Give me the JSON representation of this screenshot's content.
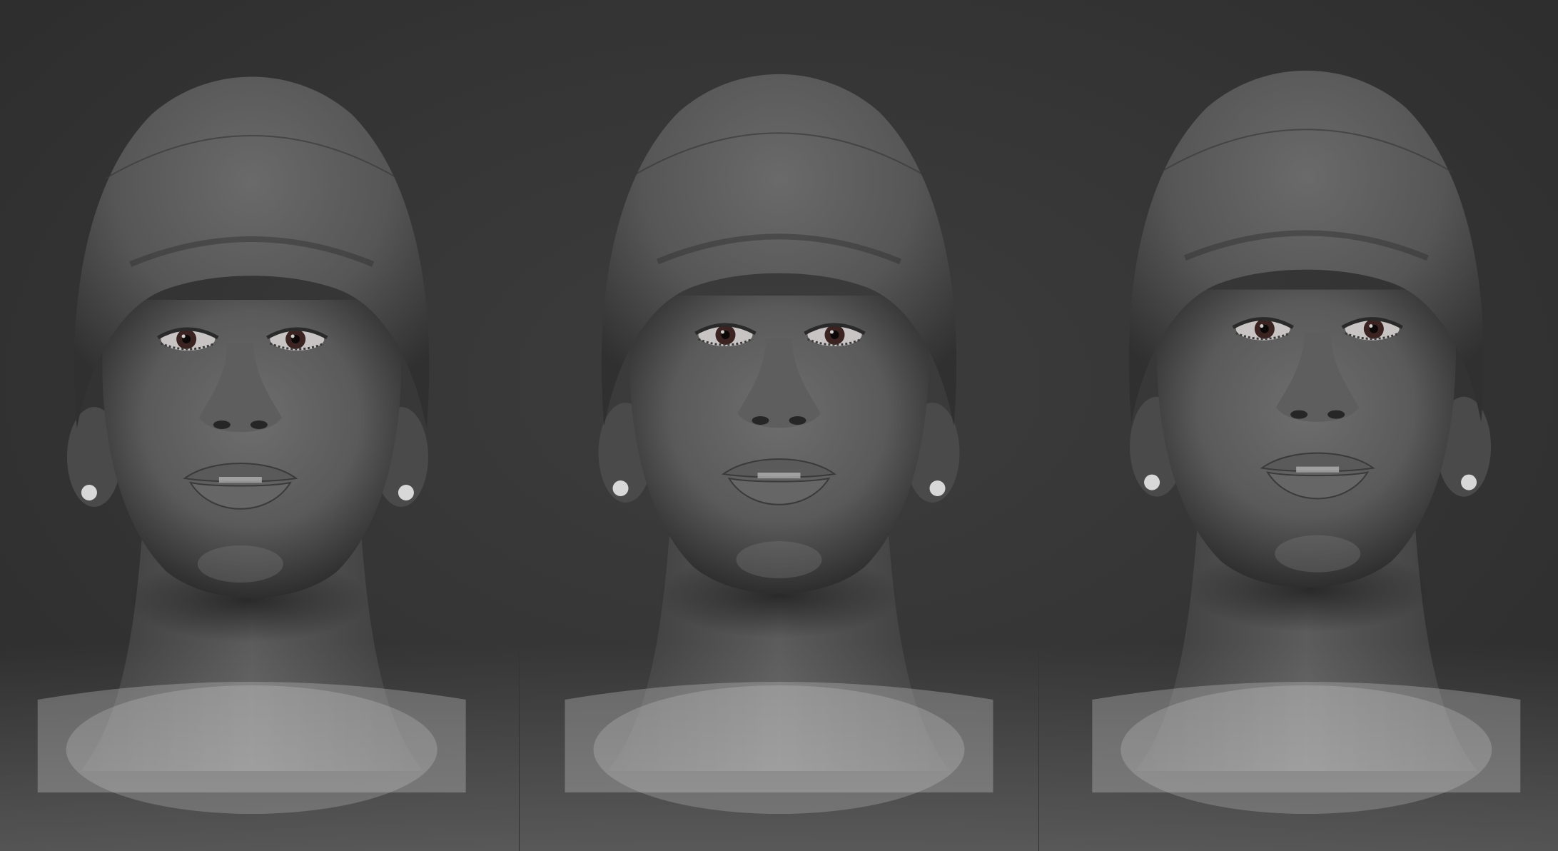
{
  "scene": {
    "background_color": "#333333",
    "skin_color": "#5a5a5a",
    "beanie_color": "#565656",
    "iris_color": "#3a2320",
    "earring_color": "#d8d8d8"
  },
  "views": [
    {
      "name": "head-left-three-quarter",
      "head_turn": -0.18,
      "head_tilt": 0.0
    },
    {
      "name": "head-front",
      "head_turn": 0.0,
      "head_tilt": -0.05
    },
    {
      "name": "head-right-three-quarter",
      "head_turn": 0.18,
      "head_tilt": -0.12
    }
  ]
}
